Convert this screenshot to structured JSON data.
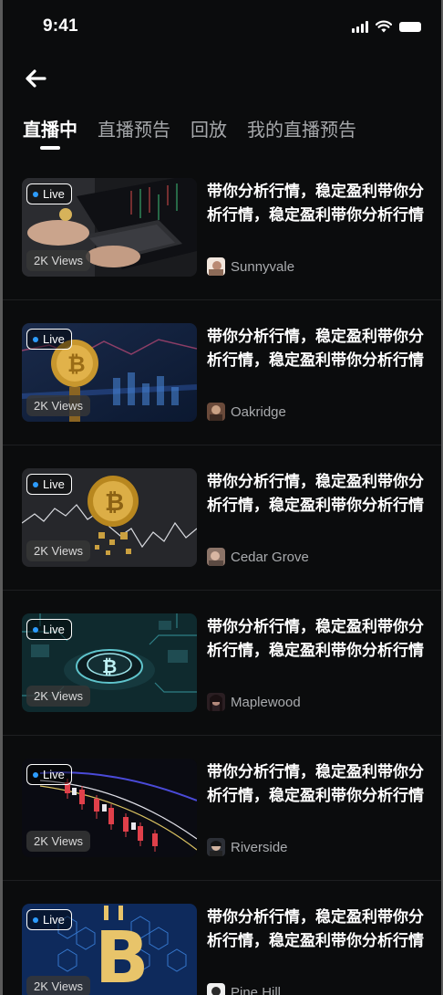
{
  "status_bar": {
    "time": "9:41",
    "icons": [
      "signal-icon",
      "wifi-icon",
      "battery-icon"
    ]
  },
  "header": {
    "back_icon": "arrow-left-icon"
  },
  "tabs": [
    {
      "label": "直播中",
      "active": true
    },
    {
      "label": "直播预告",
      "active": false
    },
    {
      "label": "回放",
      "active": false
    },
    {
      "label": "我的直播预告",
      "active": false
    }
  ],
  "streams": [
    {
      "live_label": "Live",
      "views": "2K Views",
      "title": "带你分析行情，稳定盈利带你分析行情，稳定盈利带你分析行情",
      "author": "Sunnyvale",
      "thumbnail": "trading-laptop"
    },
    {
      "live_label": "Live",
      "views": "2K Views",
      "title": "带你分析行情，稳定盈利带你分析行情，稳定盈利带你分析行情",
      "author": "Oakridge",
      "thumbnail": "bitcoin-chart-blue"
    },
    {
      "live_label": "Live",
      "views": "2K Views",
      "title": "带你分析行情，稳定盈利带你分析行情，稳定盈利带你分析行情",
      "author": "Cedar Grove",
      "thumbnail": "bitcoin-crumbling"
    },
    {
      "live_label": "Live",
      "views": "2K Views",
      "title": "带你分析行情，稳定盈利带你分析行情，稳定盈利带你分析行情",
      "author": "Maplewood",
      "thumbnail": "bitcoin-circuit"
    },
    {
      "live_label": "Live",
      "views": "2K Views",
      "title": "带你分析行情，稳定盈利带你分析行情，稳定盈利带你分析行情",
      "author": "Riverside",
      "thumbnail": "candlestick-chart"
    },
    {
      "live_label": "Live",
      "views": "2K Views",
      "title": "带你分析行情，稳定盈利带你分析行情，稳定盈利带你分析行情",
      "author": "Pine Hill",
      "thumbnail": "bitcoin-hexagon"
    }
  ],
  "colors": {
    "background": "#0b0c0d",
    "live_dot": "#2d9cff",
    "text_secondary": "#a9abae",
    "tab_inactive": "#a6a8ab"
  }
}
